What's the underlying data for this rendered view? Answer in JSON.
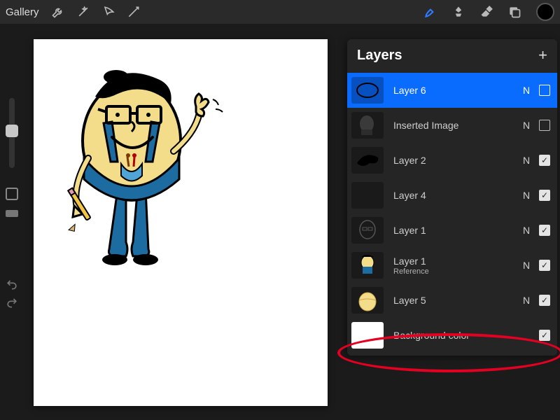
{
  "topbar": {
    "gallery_label": "Gallery",
    "icons": {
      "wrench": "wrench-icon",
      "wand": "wand-icon",
      "selection": "selection-icon",
      "move": "move-icon",
      "brush": "brush-icon",
      "smudge": "smudge-icon",
      "eraser": "eraser-icon",
      "layers": "layers-icon"
    },
    "color_swatch": "#000000"
  },
  "panel": {
    "title": "Layers",
    "add_label": "+"
  },
  "layers": [
    {
      "name": "Layer 6",
      "blend": "N",
      "visible": false,
      "selected": true,
      "subtitle": "",
      "thumb": "ellipse"
    },
    {
      "name": "Inserted Image",
      "blend": "N",
      "visible": false,
      "selected": false,
      "subtitle": "",
      "thumb": "character_dim"
    },
    {
      "name": "Layer 2",
      "blend": "N",
      "visible": true,
      "selected": false,
      "subtitle": "",
      "thumb": "hat"
    },
    {
      "name": "Layer 4",
      "blend": "N",
      "visible": true,
      "selected": false,
      "subtitle": "",
      "thumb": "blank"
    },
    {
      "name": "Layer 1",
      "blend": "N",
      "visible": true,
      "selected": false,
      "subtitle": "",
      "thumb": "outline"
    },
    {
      "name": "Layer 1",
      "blend": "N",
      "visible": true,
      "selected": false,
      "subtitle": "Reference",
      "thumb": "character_color"
    },
    {
      "name": "Layer 5",
      "blend": "N",
      "visible": true,
      "selected": false,
      "subtitle": "",
      "thumb": "egg_yellow"
    },
    {
      "name": "Background color",
      "blend": "",
      "visible": true,
      "selected": false,
      "subtitle": "",
      "thumb": "white",
      "is_bg": true
    }
  ],
  "annotation": {
    "target_index": 7
  }
}
